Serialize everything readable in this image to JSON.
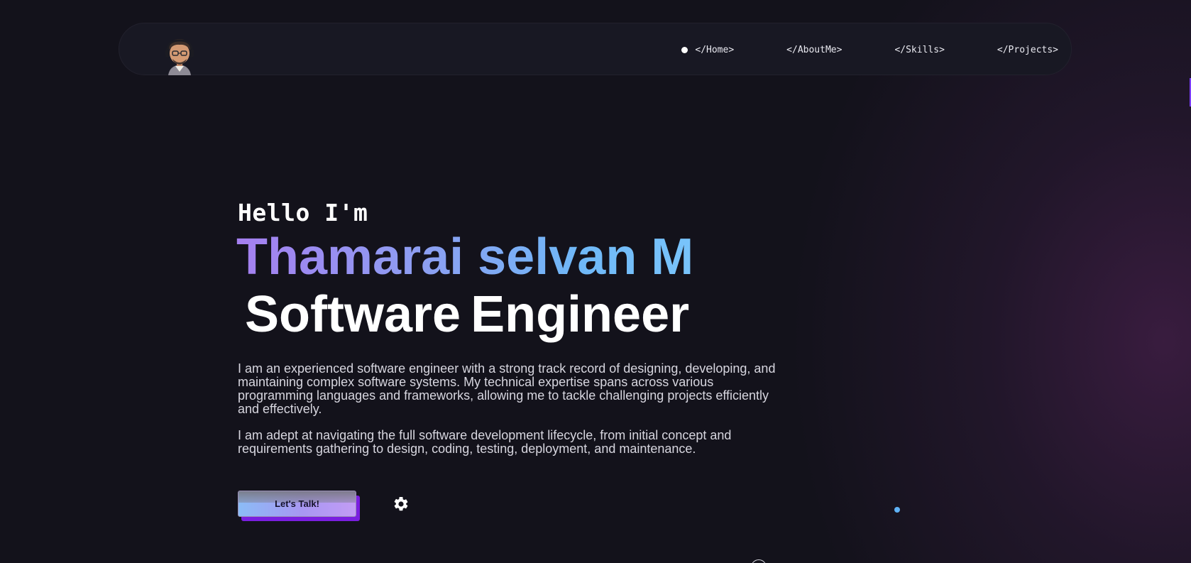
{
  "nav": {
    "items": [
      {
        "label": "</Home>",
        "active": true
      },
      {
        "label": "</AboutMe>"
      },
      {
        "label": "</Skills>"
      },
      {
        "label": "</Projects>"
      }
    ]
  },
  "hero": {
    "greeting": "Hello I'm",
    "name": "Thamarai selvan M",
    "role": "Software Engineer",
    "bio": [
      "I am an experienced software engineer with a strong track record of designing, developing, and maintaining complex software systems. My technical expertise spans across various programming languages and frameworks, allowing me to tackle challenging projects efficiently and effectively.",
      "I am adept at navigating the full software development lifecycle, from initial concept and requirements gathering to design, coding, testing, deployment, and maintenance."
    ],
    "cta_label": "Let's Talk!"
  },
  "icons": {
    "avatar": "avatar-memoji",
    "settings": "gear-icon",
    "nav_active": "dot-indicator"
  },
  "colors": {
    "background": "#13121b",
    "name_gradient_start": "#a57ff0",
    "name_gradient_end": "#79c4fb",
    "cta_accent": "#7a1fe0",
    "dot_blue": "#5fb2f5"
  }
}
